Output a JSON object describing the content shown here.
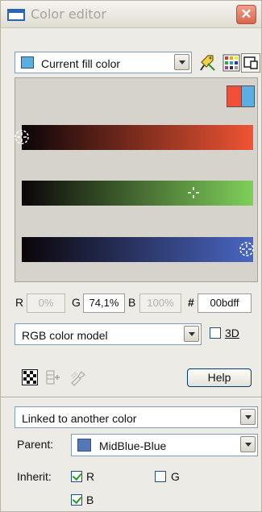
{
  "window": {
    "title": "Color editor",
    "close_glyph": "✕"
  },
  "fill_selector": {
    "value": "Current fill color",
    "swatch_color": "#5aaee0"
  },
  "toolbar": {
    "icons": [
      "eyedropper-tag-icon",
      "palette-grid-icon",
      "preview-panel-icon"
    ]
  },
  "preview": {
    "old_color": "#f0503a",
    "new_color": "#5aaee0",
    "bars": [
      {
        "channel": "R",
        "end_color": "#ef5434",
        "marker_fraction": 0.0
      },
      {
        "channel": "G",
        "end_color": "#7fcf5a",
        "marker_fraction": 0.741
      },
      {
        "channel": "B",
        "end_color": "#4a66c2",
        "marker_fraction": 1.0
      }
    ]
  },
  "values": {
    "r_label": "R",
    "r_value": "0%",
    "g_label": "G",
    "g_value": "74,1%",
    "b_label": "B",
    "b_value": "100%",
    "hex_label": "#",
    "hex_value": "00bdff"
  },
  "model": {
    "value": "RGB color model",
    "threed_label": "3D",
    "threed_checked": false
  },
  "actions": {
    "help_label": "Help"
  },
  "link": {
    "mode": "Linked to another color",
    "parent_label": "Parent:",
    "parent_value": "MidBlue-Blue",
    "parent_swatch": "#5577bb",
    "inherit_label": "Inherit:",
    "inherit": [
      {
        "label": "R",
        "checked": true
      },
      {
        "label": "G",
        "checked": false
      },
      {
        "label": "B",
        "checked": true
      }
    ]
  }
}
